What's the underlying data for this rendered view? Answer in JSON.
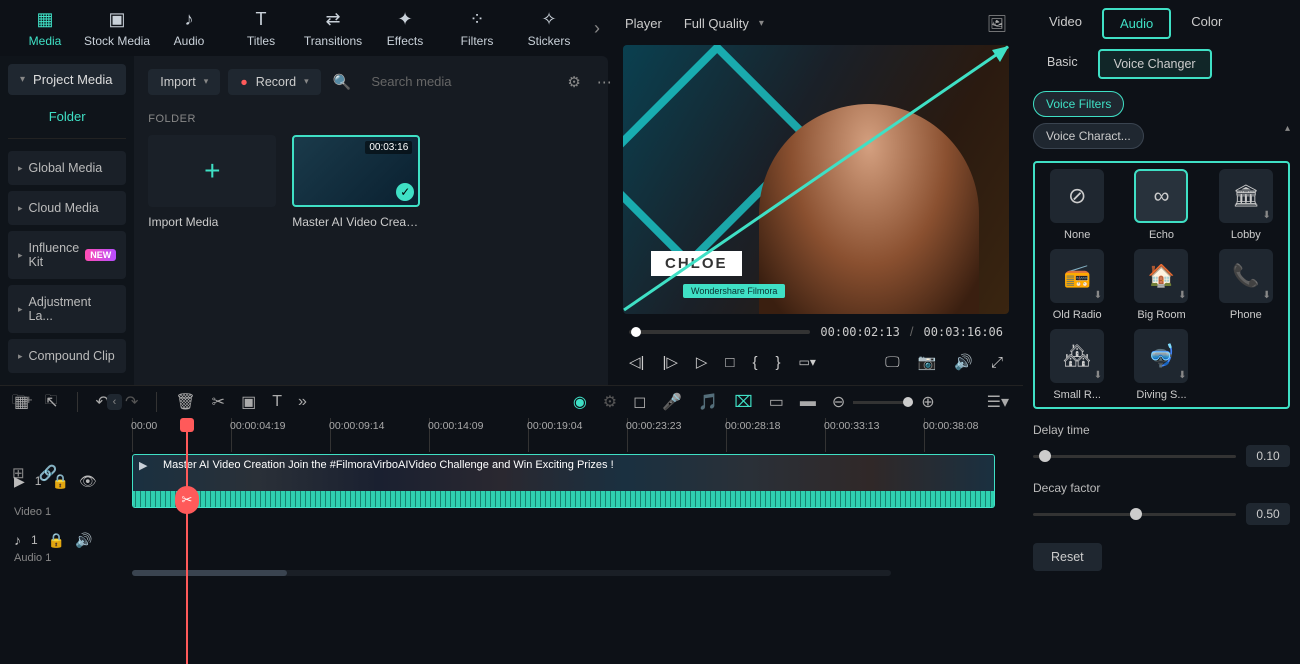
{
  "topnav": {
    "tabs": [
      {
        "label": "Media",
        "icon": "▦"
      },
      {
        "label": "Stock Media",
        "icon": "▣"
      },
      {
        "label": "Audio",
        "icon": "♪"
      },
      {
        "label": "Titles",
        "icon": "T"
      },
      {
        "label": "Transitions",
        "icon": "⇄"
      },
      {
        "label": "Effects",
        "icon": "✦"
      },
      {
        "label": "Filters",
        "icon": "⁘"
      },
      {
        "label": "Stickers",
        "icon": "✧"
      }
    ]
  },
  "sidebar": {
    "project_media": "Project Media",
    "folder": "Folder",
    "items": [
      {
        "label": "Global Media"
      },
      {
        "label": "Cloud Media"
      },
      {
        "label": "Influence Kit",
        "badge": "NEW"
      },
      {
        "label": "Adjustment La..."
      },
      {
        "label": "Compound Clip"
      }
    ]
  },
  "mediabrowser": {
    "import": "Import",
    "record": "Record",
    "search_placeholder": "Search media",
    "folder_label": "FOLDER",
    "import_media": "Import Media",
    "clip_name": "Master AI Video Creati...",
    "clip_dur": "00:03:16"
  },
  "player": {
    "label": "Player",
    "quality": "Full Quality",
    "name_overlay": "CHLOE",
    "sub_overlay": "Wondershare Filmora",
    "tc_current": "00:00:02:13",
    "tc_total": "00:03:16:06"
  },
  "inspector": {
    "tabs": {
      "video": "Video",
      "audio": "Audio",
      "color": "Color"
    },
    "subtabs": {
      "basic": "Basic",
      "voice_changer": "Voice Changer"
    },
    "pills": {
      "voice_filters": "Voice Filters",
      "voice_charact": "Voice Charact..."
    },
    "cards": [
      {
        "label": "None",
        "icon": "⊘"
      },
      {
        "label": "Echo",
        "icon": "∞"
      },
      {
        "label": "Lobby",
        "icon": "🏛"
      },
      {
        "label": "Old Radio",
        "icon": "📻"
      },
      {
        "label": "Big Room",
        "icon": "🏠"
      },
      {
        "label": "Phone",
        "icon": "📞"
      },
      {
        "label": "Small R...",
        "icon": "🏘"
      },
      {
        "label": "Diving S...",
        "icon": "🤿"
      }
    ],
    "delay_label": "Delay time",
    "delay_val": "0.10",
    "decay_label": "Decay factor",
    "decay_val": "0.50",
    "reset": "Reset"
  },
  "timeline": {
    "ruler": [
      "00:00",
      "00:00:04:19",
      "00:00:09:14",
      "00:00:14:09",
      "00:00:19:04",
      "00:00:23:23",
      "00:00:28:18",
      "00:00:33:13",
      "00:00:38:08"
    ],
    "video_track": "Video 1",
    "audio_track": "Audio 1",
    "clip_title": "Master AI Video Creation   Join the #FilmoraVirboAIVideo Challenge and Win Exciting Prizes !"
  }
}
